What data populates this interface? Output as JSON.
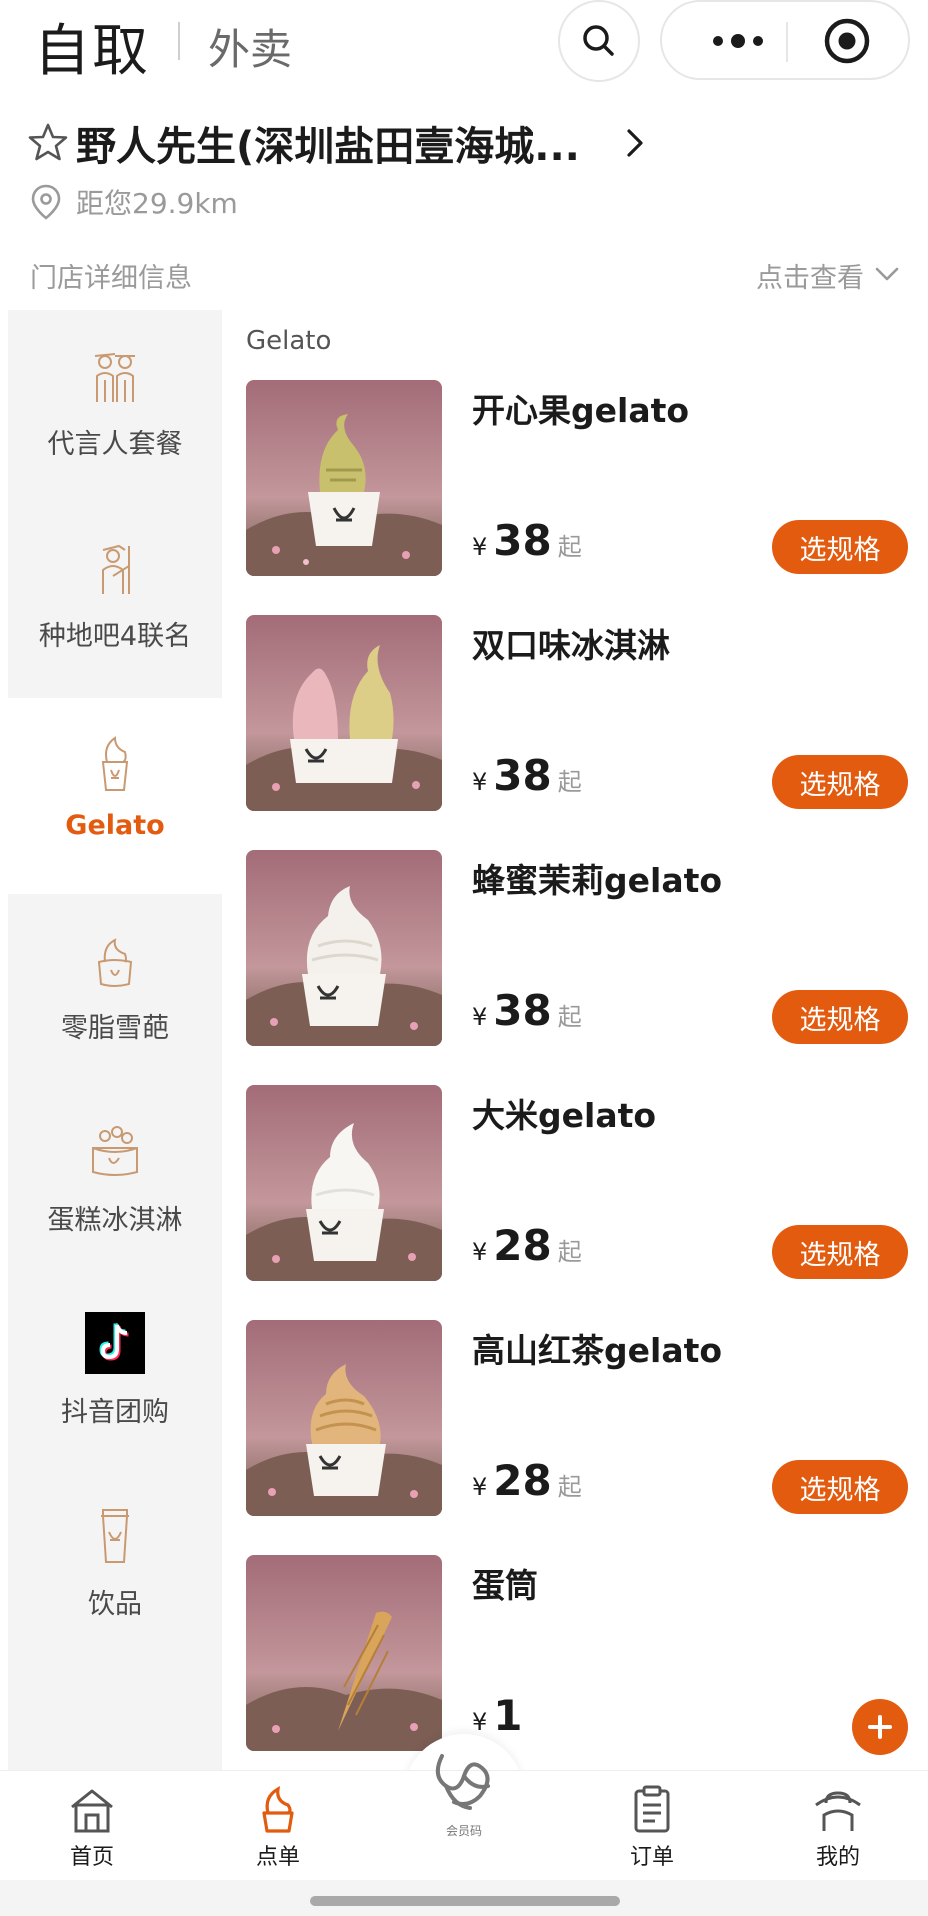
{
  "header": {
    "mode_pickup": "自取",
    "mode_delivery": "外卖"
  },
  "store": {
    "name": "野人先生(深圳盐田壹海城...",
    "distance": "距您29.9km",
    "detail_label": "门店详细信息",
    "detail_link": "点击查看"
  },
  "sidebar": {
    "items": [
      {
        "label": "代言人套餐",
        "icon": "spokesperson-icon"
      },
      {
        "label": "种地吧4联名",
        "icon": "farmer-icon"
      },
      {
        "label": "Gelato",
        "icon": "gelato-cup-icon"
      },
      {
        "label": "零脂雪葩",
        "icon": "sorbet-icon"
      },
      {
        "label": "蛋糕冰淇淋",
        "icon": "cake-icecream-icon"
      },
      {
        "label": "抖音团购",
        "icon": "douyin-icon"
      },
      {
        "label": "饮品",
        "icon": "drink-cup-icon"
      }
    ],
    "active_index": 2
  },
  "section_title": "Gelato",
  "products": [
    {
      "name": "开心果gelato",
      "currency": "¥",
      "price": "38",
      "suffix": "起",
      "button": "选规格",
      "image": "pistachio-gelato"
    },
    {
      "name": "双口味冰淇淋",
      "currency": "¥",
      "price": "38",
      "suffix": "起",
      "button": "选规格",
      "image": "double-flavor-gelato"
    },
    {
      "name": "蜂蜜茉莉gelato",
      "currency": "¥",
      "price": "38",
      "suffix": "起",
      "button": "选规格",
      "image": "honey-jasmine-gelato"
    },
    {
      "name": "大米gelato",
      "currency": "¥",
      "price": "28",
      "suffix": "起",
      "button": "选规格",
      "image": "rice-gelato"
    },
    {
      "name": "高山红茶gelato",
      "currency": "¥",
      "price": "28",
      "suffix": "起",
      "button": "选规格",
      "image": "black-tea-gelato"
    },
    {
      "name": "蛋筒",
      "currency": "¥",
      "price": "1",
      "suffix": "",
      "button": "+",
      "image": "waffle-cone"
    }
  ],
  "bottom_nav": {
    "home": "首页",
    "order_menu": "点单",
    "member": "会员码",
    "orders": "订单",
    "mine": "我的"
  },
  "colors": {
    "accent": "#e35b0f",
    "sidebar_bg": "#f4f4f4",
    "image_bg": "#b07f86"
  }
}
